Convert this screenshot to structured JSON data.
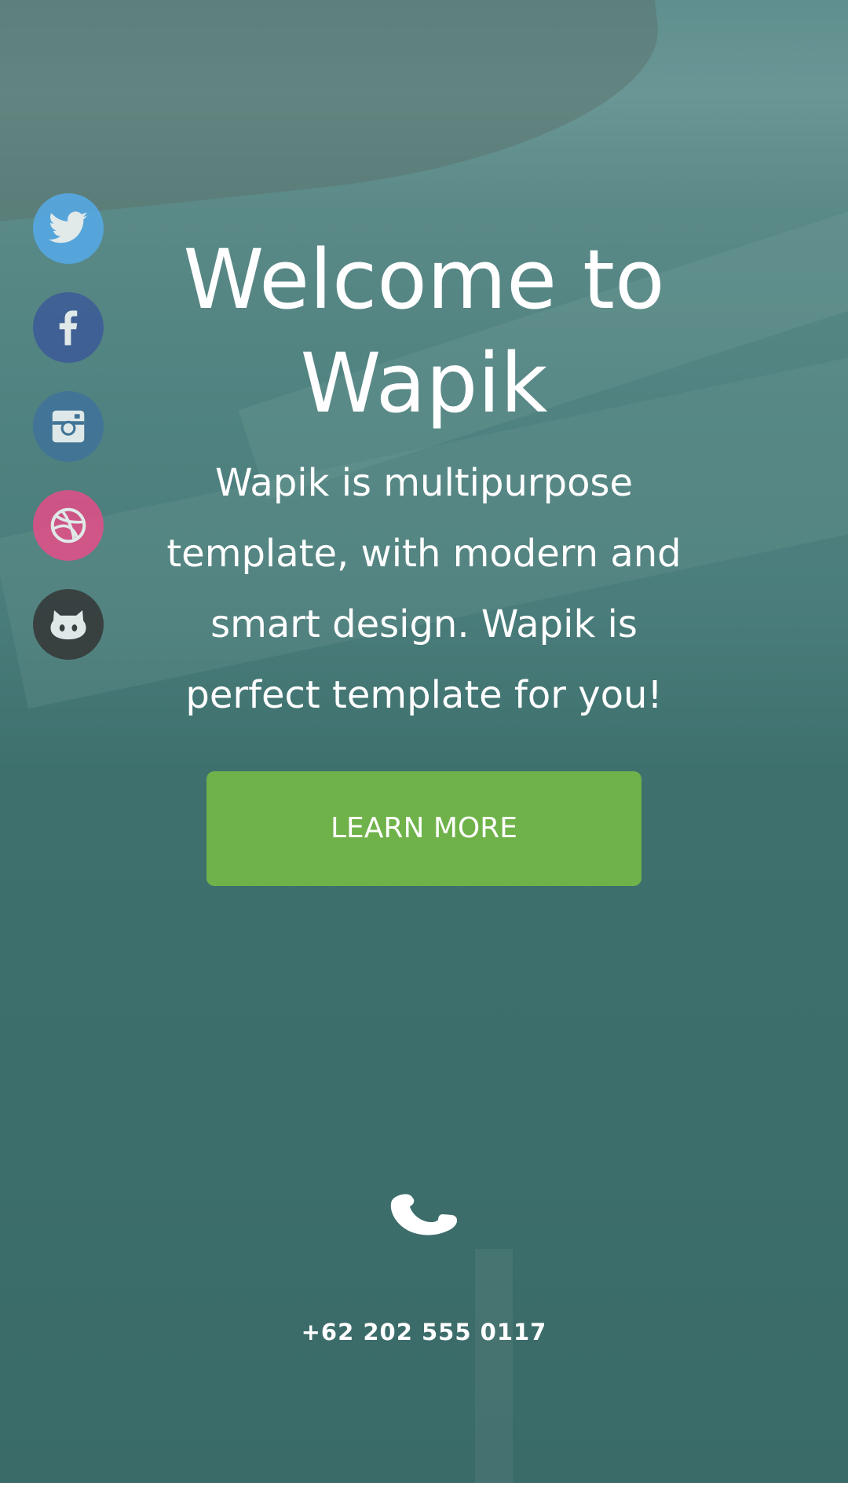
{
  "social": [
    {
      "icon": "twitter-icon",
      "color": "#55acee"
    },
    {
      "icon": "facebook-icon",
      "color": "#3b5998"
    },
    {
      "icon": "instagram-icon",
      "color": "#3f729b"
    },
    {
      "icon": "dribbble-icon",
      "color": "#ea4c89"
    },
    {
      "icon": "github-icon",
      "color": "#333333"
    }
  ],
  "hero": {
    "title": "Welcome to Wapik",
    "text": "Wapik is multipurpose template, with modern and smart design. Wapik is perfect template for you!",
    "cta_label": "LEARN MORE",
    "cta_color": "#6fb24a"
  },
  "contact": {
    "icon": "phone-icon",
    "phone": "+62 202 555 0117"
  }
}
